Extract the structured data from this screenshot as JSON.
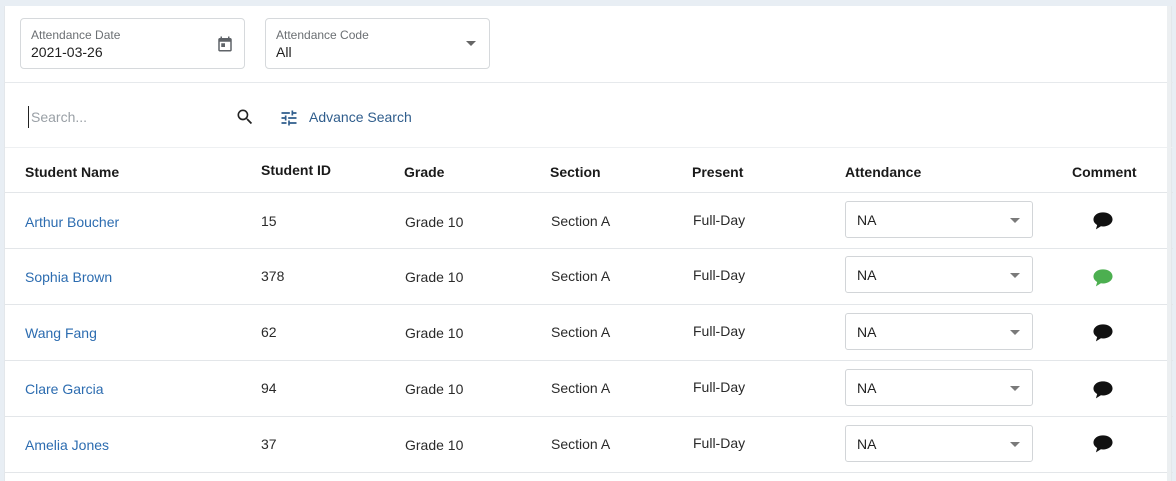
{
  "filters": {
    "date": {
      "label": "Attendance Date",
      "value": "2021-03-26",
      "icon": "calendar-icon"
    },
    "code": {
      "label": "Attendance Code",
      "value": "All",
      "icon": "chevron-down-icon"
    }
  },
  "search": {
    "placeholder": "Search...",
    "icon": "search-icon",
    "advance_label": "Advance Search",
    "advance_icon": "tune-icon"
  },
  "table": {
    "columns": [
      "Student Name",
      "Student ID",
      "Grade",
      "Section",
      "Present",
      "Attendance",
      "Comment"
    ],
    "rows": [
      {
        "name": "Arthur Boucher",
        "id": "15",
        "grade": "Grade 10",
        "section": "Section A",
        "present": "Full-Day",
        "attendance": "NA",
        "comment_color": "#111111"
      },
      {
        "name": "Sophia Brown",
        "id": "378",
        "grade": "Grade 10",
        "section": "Section A",
        "present": "Full-Day",
        "attendance": "NA",
        "comment_color": "#4caf50"
      },
      {
        "name": "Wang Fang",
        "id": "62",
        "grade": "Grade 10",
        "section": "Section A",
        "present": "Full-Day",
        "attendance": "NA",
        "comment_color": "#111111"
      },
      {
        "name": "Clare Garcia",
        "id": "94",
        "grade": "Grade 10",
        "section": "Section A",
        "present": "Full-Day",
        "attendance": "NA",
        "comment_color": "#111111"
      },
      {
        "name": "Amelia Jones",
        "id": "37",
        "grade": "Grade 10",
        "section": "Section A",
        "present": "Full-Day",
        "attendance": "NA",
        "comment_color": "#111111"
      }
    ]
  },
  "colors": {
    "link": "#2c6cb0",
    "comment_default": "#111111",
    "comment_active": "#4caf50"
  }
}
